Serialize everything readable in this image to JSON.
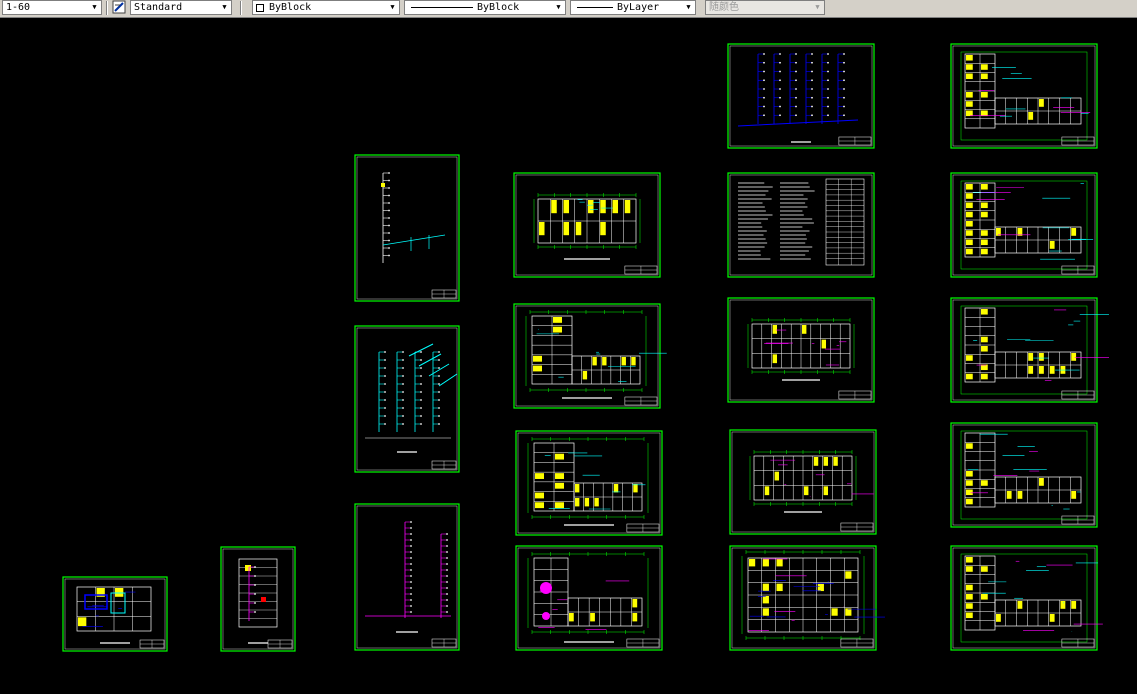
{
  "toolbar": {
    "scale": "1-60",
    "text_style": "Standard",
    "color": "ByBlock",
    "linetype": "ByBlock",
    "lineweight": "ByLayer",
    "plot_style": "随颜色"
  },
  "colors": {
    "background": "#000000",
    "sheet_border": "#00ff00",
    "wall": "#ffffff",
    "room_fill": "#ffff00",
    "pipe_blue": "#0000ff",
    "pipe_magenta": "#ff00ff",
    "pipe_cyan": "#00ffff",
    "toolbar_bg": "#d4d0c8"
  },
  "sheets": [
    {
      "name": "sheet-site-plan",
      "kind": "plan_small"
    },
    {
      "name": "sheet-narrow-plan",
      "kind": "plan_tall"
    },
    {
      "name": "sheet-riser-1",
      "kind": "riser_a"
    },
    {
      "name": "sheet-riser-2",
      "kind": "riser_b"
    },
    {
      "name": "sheet-riser-3",
      "kind": "riser_c"
    },
    {
      "name": "sheet-floor-plan-1",
      "kind": "plan_small_bldg"
    },
    {
      "name": "sheet-floor-plan-2",
      "kind": "plan_l"
    },
    {
      "name": "sheet-floor-plan-3",
      "kind": "plan_l"
    },
    {
      "name": "sheet-floor-plan-4",
      "kind": "plan_l_color"
    },
    {
      "name": "sheet-system-diagram",
      "kind": "riser_blue"
    },
    {
      "name": "sheet-design-notes",
      "kind": "notes"
    },
    {
      "name": "sheet-floor-plan-5",
      "kind": "plan_wide"
    },
    {
      "name": "sheet-floor-plan-6",
      "kind": "plan_wide"
    },
    {
      "name": "sheet-floor-plan-7",
      "kind": "plan_grid"
    },
    {
      "name": "sheet-floor-plan-8",
      "kind": "plan_corner"
    },
    {
      "name": "sheet-floor-plan-9",
      "kind": "plan_corner"
    },
    {
      "name": "sheet-floor-plan-10",
      "kind": "plan_corner"
    },
    {
      "name": "sheet-floor-plan-11",
      "kind": "plan_corner"
    },
    {
      "name": "sheet-floor-plan-12",
      "kind": "plan_corner"
    }
  ]
}
